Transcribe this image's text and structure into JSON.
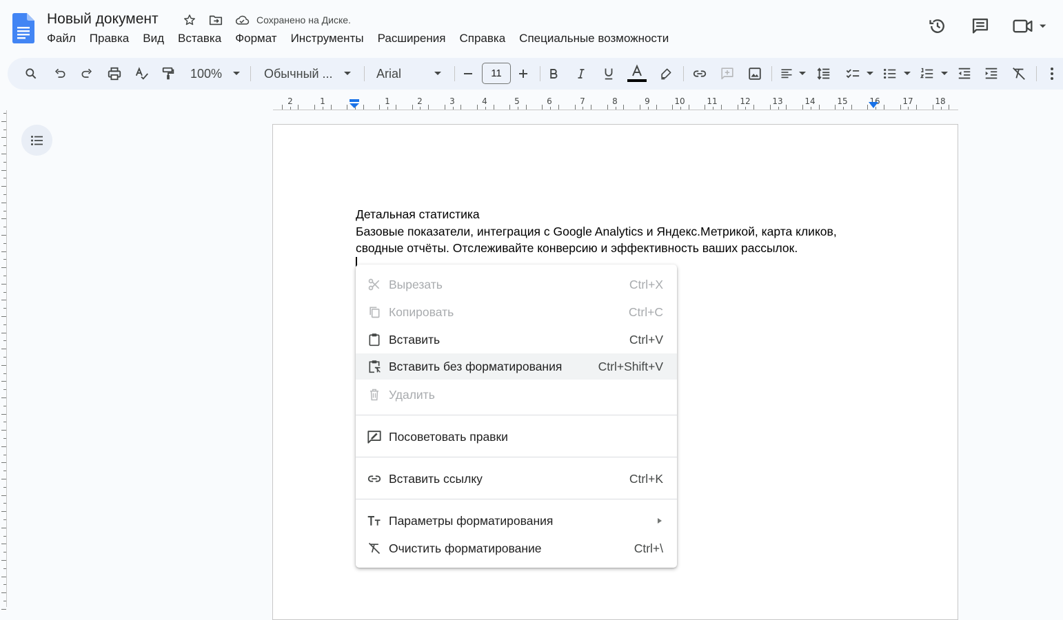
{
  "document": {
    "title": "Новый документ",
    "saved_status": "Сохранено на Диске."
  },
  "menu": [
    "Файл",
    "Правка",
    "Вид",
    "Вставка",
    "Формат",
    "Инструменты",
    "Расширения",
    "Справка",
    "Специальные возможности"
  ],
  "toolbar": {
    "zoom": "100%",
    "style": "Обычный ...",
    "font": "Arial",
    "font_size": "11"
  },
  "ruler": {
    "labels": [
      "2",
      "1",
      "1",
      "2",
      "3",
      "4",
      "5",
      "6",
      "7",
      "8",
      "9",
      "10",
      "11",
      "12",
      "13",
      "14",
      "15",
      "16",
      "17",
      "18"
    ]
  },
  "content": {
    "line1": "Детальная статистика",
    "line2": "Базовые показатели, интеграция с Google Analytics и Яндекс.Метрикой, карта кликов,",
    "line3": "сводные отчёты. Отслеживайте конверсию и эффективность ваших рассылок."
  },
  "context_menu": {
    "cut": {
      "label": "Вырезать",
      "shortcut": "Ctrl+X"
    },
    "copy": {
      "label": "Копировать",
      "shortcut": "Ctrl+C"
    },
    "paste": {
      "label": "Вставить",
      "shortcut": "Ctrl+V"
    },
    "paste_plain": {
      "label": "Вставить без форматирования",
      "shortcut": "Ctrl+Shift+V"
    },
    "delete": {
      "label": "Удалить"
    },
    "suggest": {
      "label": "Посоветовать правки"
    },
    "insert_link": {
      "label": "Вставить ссылку",
      "shortcut": "Ctrl+K"
    },
    "format_options": {
      "label": "Параметры форматирования"
    },
    "clear_format": {
      "label": "Очистить форматирование",
      "shortcut": "Ctrl+\\"
    }
  },
  "colors": {
    "docs_blue": "#4285f4",
    "text_color_bar": "#000000",
    "toolbar_bg": "#edf2fa"
  }
}
